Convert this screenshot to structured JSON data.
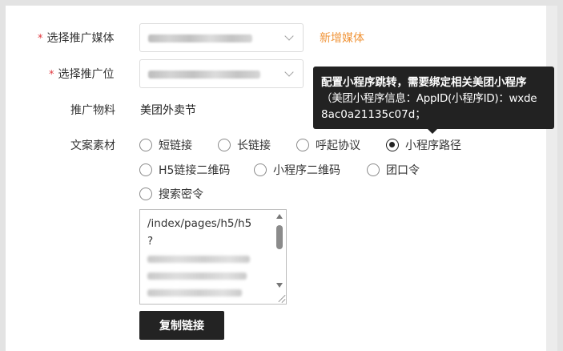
{
  "form": {
    "media_label": "选择推广媒体",
    "position_label": "选择推广位",
    "material_label": "推广物料",
    "material_value": "美团外卖节",
    "copy_label": "文案素材",
    "add_media_link": "新增媒体",
    "required_mark": "*"
  },
  "radios": [
    {
      "label": "短链接",
      "checked": false
    },
    {
      "label": "长链接",
      "checked": false
    },
    {
      "label": "呼起协议",
      "checked": false
    },
    {
      "label": "小程序路径",
      "checked": true
    },
    {
      "label": "H5链接二维码",
      "checked": false
    },
    {
      "label": "小程序二维码",
      "checked": false
    },
    {
      "label": "团口令",
      "checked": false
    },
    {
      "label": "搜索密令",
      "checked": false
    }
  ],
  "textarea": {
    "line1": "/index/pages/h5/h5",
    "line2": "?"
  },
  "button": {
    "copy_link": "复制链接"
  },
  "tooltip": {
    "line1": "配置小程序跳转，需要绑定相关美团小程序",
    "line2": "（美团小程序信息：AppID(小程序ID)：wxde",
    "line3": "8ac0a21135c07d；"
  },
  "colors": {
    "accent_orange": "#f0953a",
    "required_red": "#e0383e",
    "button_bg": "#232323",
    "tooltip_bg": "#222222"
  }
}
